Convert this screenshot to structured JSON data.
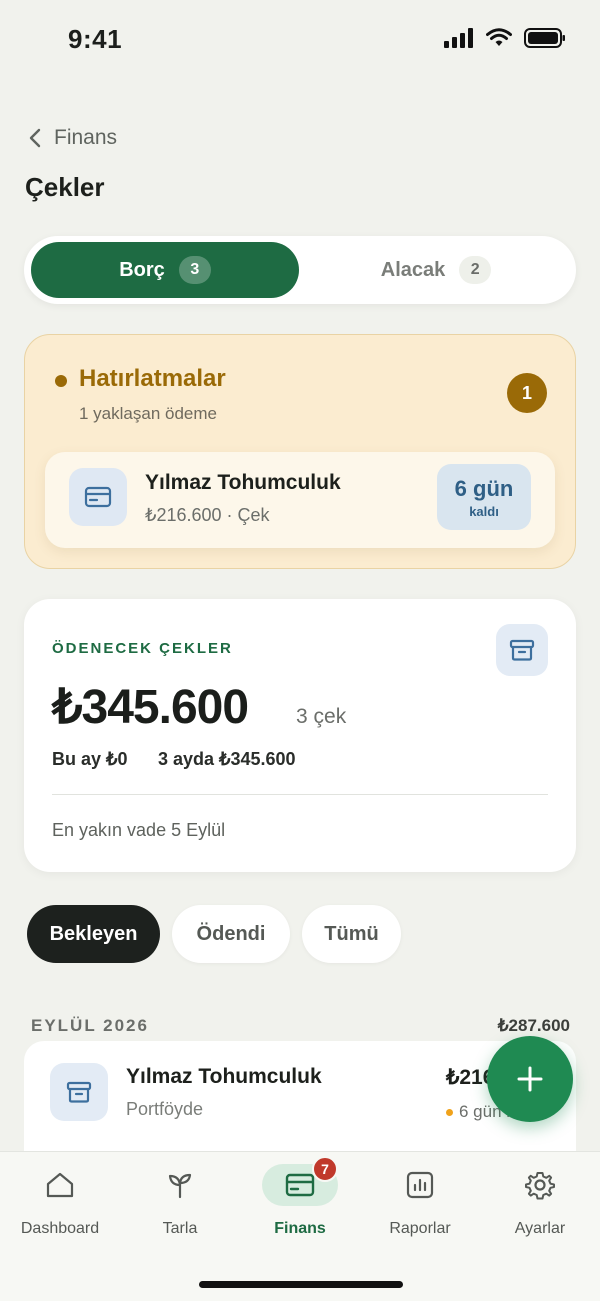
{
  "status_bar": {
    "time": "9:41"
  },
  "header": {
    "back_label": "Finans",
    "title": "Çekler"
  },
  "segment": {
    "tabs": [
      {
        "label": "Borç",
        "count": "3"
      },
      {
        "label": "Alacak",
        "count": "2"
      }
    ]
  },
  "reminders": {
    "title": "Hatırlatmalar",
    "subtitle": "1 yaklaşan ödeme",
    "badge": "1",
    "item": {
      "name": "Yılmaz Tohumculuk",
      "meta": "₺216.600 · Çek",
      "days": "6 gün",
      "days_label": "kaldı"
    }
  },
  "summary": {
    "label": "ÖDENECEK ÇEKLER",
    "amount": "₺345.600",
    "count": "3 çek",
    "this_month": "Bu ay ₺0",
    "three_months": "3 ayda ₺345.600",
    "nearest_due": "En yakın vade 5 Eylül"
  },
  "filters": [
    "Bekleyen",
    "Ödendi",
    "Tümü"
  ],
  "group": {
    "month": "EYLÜL 2026",
    "total": "₺287.600",
    "rows": [
      {
        "name": "Yılmaz Tohumculuk",
        "status": "Portföyde",
        "amount": "₺216.600",
        "days": "6 gün kaldı"
      }
    ]
  },
  "bottom_nav": {
    "items": [
      {
        "label": "Dashboard",
        "icon": "home-icon"
      },
      {
        "label": "Tarla",
        "icon": "sprout-icon"
      },
      {
        "label": "Finans",
        "icon": "card-icon",
        "badge": "7"
      },
      {
        "label": "Raporlar",
        "icon": "chart-icon"
      },
      {
        "label": "Ayarlar",
        "icon": "gear-icon"
      }
    ]
  },
  "colors": {
    "primary": "#1e6b43",
    "fab": "#1f8a52",
    "warning": "#9a6a07",
    "badge": "#c0392b"
  }
}
